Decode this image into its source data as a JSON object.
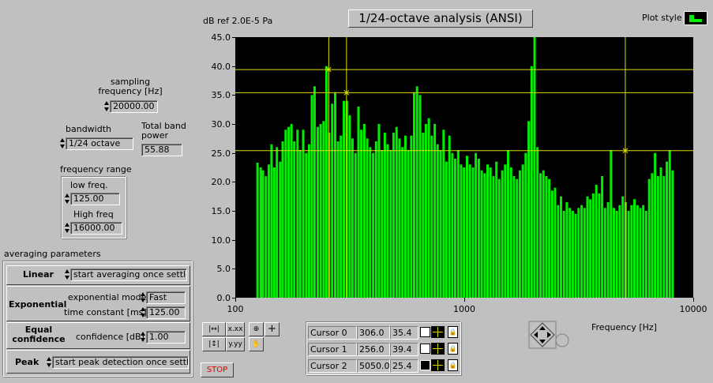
{
  "controls": {
    "sampling_label": "sampling\nfrequency [Hz]",
    "sampling_value": "20000.00",
    "bandwidth_label": "bandwidth",
    "bandwidth_value": "1/24 octave",
    "total_power_label": "Total band\npower",
    "total_power_value": "55.88",
    "freq_range_label": "frequency range",
    "low_label": "low freq.",
    "low_value": "125.00",
    "high_label": "High freq",
    "high_value": "16000.00"
  },
  "averaging": {
    "title": "averaging parameters",
    "linear_label": "Linear",
    "linear_value": "start averaging once settled",
    "exp_label": "Exponential",
    "exp_mode_label": "exponential mode",
    "exp_mode_value": "Fast",
    "time_const_label": "time constant [ms]",
    "time_const_value": "125.00",
    "equal_label": "Equal\nconfidence",
    "confidence_label": "confidence [dB]",
    "confidence_value": "1.00",
    "peak_label": "Peak",
    "peak_value": "start peak detection once settled"
  },
  "graph": {
    "title": "1/24-octave analysis (ANSI)",
    "ref_label": "dB ref 2.0E-5 Pa",
    "plot_style_label": "Plot style",
    "xlabel": "Frequency [Hz]",
    "stop_label": "STOP"
  },
  "cursors": [
    {
      "name": "Cursor 0",
      "x": "306.0",
      "y": "35.4"
    },
    {
      "name": "Cursor 1",
      "x": "256.0",
      "y": "39.4"
    },
    {
      "name": "Cursor 2",
      "x": "5050.0",
      "y": "25.4"
    }
  ],
  "colors": {
    "bars": "#00ee00",
    "cursor": "#e0e000",
    "plot_bg": "#000000",
    "panel": "#c0c0c0"
  },
  "chart_data": {
    "type": "bar",
    "title": "1/24-octave analysis (ANSI)",
    "xlabel": "Frequency [Hz]",
    "ylabel": "dB ref 2.0E-5 Pa",
    "xscale": "log",
    "xlim": [
      100,
      10000
    ],
    "ylim": [
      0,
      45
    ],
    "yticks": [
      "0.0",
      "5.0",
      "10.0",
      "15.0",
      "20.0",
      "25.0",
      "30.0",
      "35.0",
      "40.0",
      "45.0"
    ],
    "xticks": [
      "100",
      "1000",
      "10000"
    ],
    "grid": "cursor lines only",
    "x": [
      125,
      129,
      132,
      136,
      140,
      144,
      148,
      152,
      157,
      161,
      166,
      171,
      176,
      181,
      187,
      192,
      198,
      204,
      210,
      216,
      222,
      229,
      236,
      243,
      250,
      257,
      265,
      273,
      281,
      289,
      298,
      307,
      316,
      325,
      335,
      345,
      355,
      366,
      377,
      388,
      400,
      412,
      424,
      437,
      450,
      463,
      477,
      491,
      506,
      521,
      537,
      553,
      570,
      587,
      604,
      622,
      641,
      660,
      680,
      700,
      721,
      743,
      765,
      788,
      812,
      836,
      861,
      887,
      913,
      941,
      969,
      998,
      1028,
      1059,
      1091,
      1123,
      1157,
      1191,
      1227,
      1264,
      1302,
      1341,
      1381,
      1422,
      1465,
      1509,
      1554,
      1601,
      1649,
      1698,
      1749,
      1801,
      1855,
      1911,
      1968,
      2027,
      2088,
      2151,
      2215,
      2282,
      2350,
      2421,
      2493,
      2568,
      2645,
      2724,
      2806,
      2890,
      2977,
      3066,
      3158,
      3253,
      3350,
      3451,
      3554,
      3661,
      3771,
      3884,
      4000,
      4120,
      4244,
      4371,
      4502,
      4637,
      4776,
      4920,
      5067,
      5219,
      5376,
      5537,
      5703,
      5874,
      6050,
      6232,
      6419,
      6611,
      6810,
      7014,
      7224,
      7441,
      7664,
      7894,
      8131
    ],
    "values": [
      23.3,
      22.5,
      22.0,
      21.0,
      23.0,
      26.5,
      22.5,
      26.0,
      23.5,
      27.0,
      29.0,
      29.5,
      30.0,
      27.0,
      29.0,
      25.5,
      29.0,
      25.0,
      26.5,
      35.0,
      36.5,
      29.5,
      30.0,
      30.5,
      40.0,
      28.5,
      33.5,
      35.5,
      27.0,
      28.0,
      34.0,
      34.0,
      31.5,
      27.5,
      25.0,
      33.0,
      29.0,
      30.0,
      27.5,
      26.0,
      25.0,
      27.0,
      30.0,
      25.5,
      28.5,
      26.5,
      25.5,
      28.5,
      29.5,
      27.5,
      26.0,
      28.0,
      25.5,
      28.0,
      35.5,
      36.5,
      35.0,
      28.5,
      30.0,
      31.0,
      28.0,
      30.0,
      26.5,
      25.5,
      29.0,
      23.5,
      28.0,
      25.0,
      24.0,
      25.5,
      23.0,
      22.5,
      24.5,
      23.0,
      22.5,
      25.0,
      24.0,
      22.0,
      21.5,
      23.0,
      22.5,
      21.0,
      23.5,
      20.5,
      22.0,
      23.0,
      25.5,
      22.5,
      21.0,
      20.5,
      22.0,
      23.0,
      25.0,
      30.5,
      40.0,
      45.0,
      26.0,
      21.5,
      22.0,
      21.0,
      20.5,
      18.5,
      19.0,
      16.0,
      17.5,
      15.0,
      16.5,
      15.5,
      15.0,
      14.5,
      15.5,
      16.0,
      15.5,
      17.5,
      17.0,
      18.0,
      19.5,
      18.0,
      21.0,
      15.5,
      16.5,
      25.5,
      15.5,
      15.0,
      16.0,
      17.5,
      16.5,
      15.0,
      16.0,
      17.0,
      16.0,
      15.5,
      16.0,
      15.0,
      20.5,
      21.5,
      25.0,
      21.0,
      22.5,
      21.0,
      23.5,
      25.5,
      22.0,
      25.5,
      17.0
    ],
    "cursors": [
      {
        "x": 306.0,
        "y": 35.4
      },
      {
        "x": 256.0,
        "y": 39.4
      },
      {
        "x": 5050.0,
        "y": 25.4
      }
    ]
  }
}
